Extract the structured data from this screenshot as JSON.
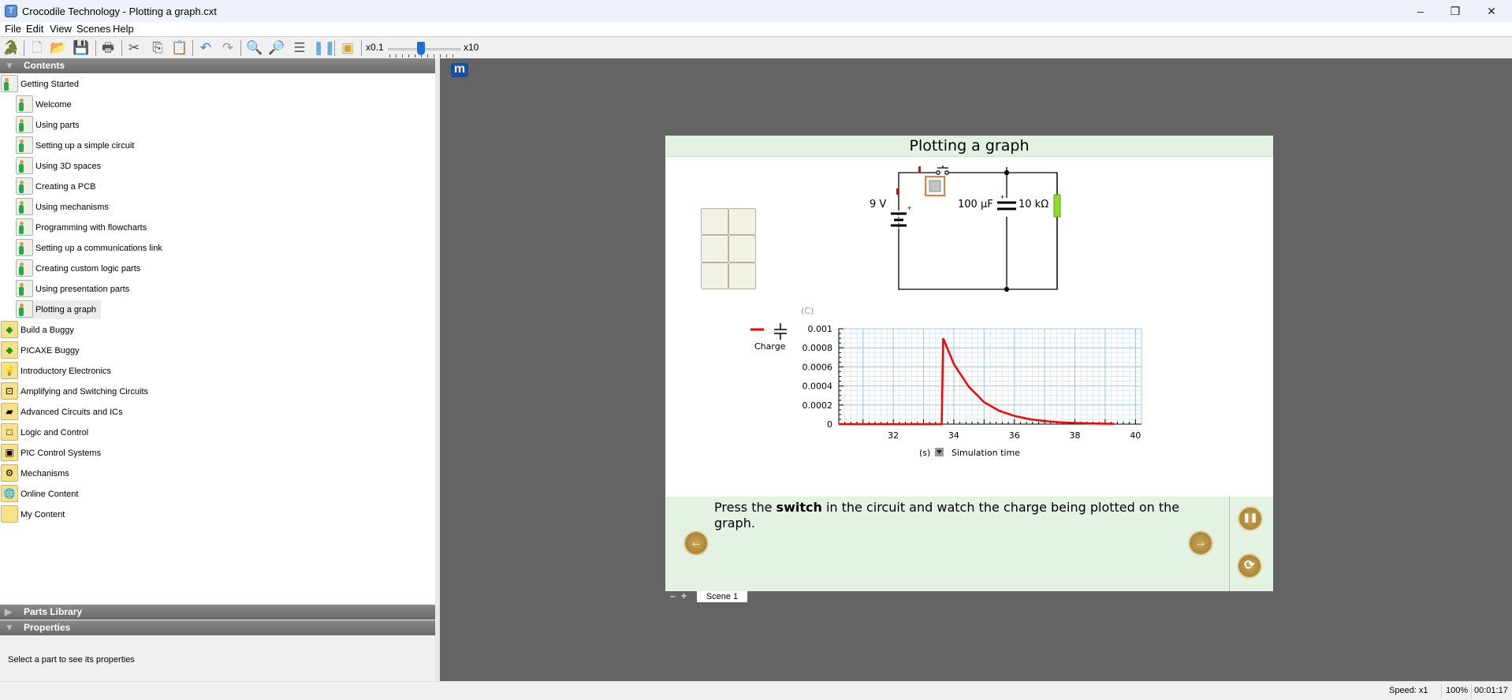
{
  "window": {
    "title": "Crocodile Technology - Plotting a graph.cxt",
    "app_icon": "T",
    "minimize": "–",
    "maximize": "❐",
    "close": "✕"
  },
  "menu": [
    "File",
    "Edit",
    "View",
    "Scenes",
    "Help"
  ],
  "toolbar": {
    "icons": [
      "crocodile-icon",
      "new-icon",
      "open-icon",
      "save-icon",
      "print-icon",
      "cut-icon",
      "copy-icon",
      "paste-icon",
      "undo-icon",
      "redo-icon",
      "zoom-in-icon",
      "zoom-out-icon",
      "fit-icon",
      "pause-icon",
      "presentation-icon"
    ],
    "speed_min": "x0.1",
    "speed_max": "x10",
    "speed_value": 0.5
  },
  "panels": {
    "contents": "Contents",
    "parts_library": "Parts Library",
    "properties": "Properties",
    "properties_hint": "Select a part to see its properties"
  },
  "tree": [
    {
      "label": "Getting Started",
      "level": 0,
      "icon": "tutorial-folder"
    },
    {
      "label": "Welcome",
      "level": 1
    },
    {
      "label": "Using parts",
      "level": 1
    },
    {
      "label": "Setting up a simple circuit",
      "level": 1
    },
    {
      "label": "Using 3D spaces",
      "level": 1
    },
    {
      "label": "Creating a PCB",
      "level": 1
    },
    {
      "label": "Using mechanisms",
      "level": 1
    },
    {
      "label": "Programming with flowcharts",
      "level": 1
    },
    {
      "label": "Setting up a communications link",
      "level": 1
    },
    {
      "label": "Creating custom logic parts",
      "level": 1
    },
    {
      "label": "Using presentation parts",
      "level": 1
    },
    {
      "label": "Plotting a graph",
      "level": 1,
      "selected": true
    },
    {
      "label": "Build a Buggy",
      "level": 0,
      "icon": "buggy"
    },
    {
      "label": "PICAXE Buggy",
      "level": 0,
      "icon": "buggy"
    },
    {
      "label": "Introductory Electronics",
      "level": 0,
      "icon": "bulb"
    },
    {
      "label": "Amplifying and Switching Circuits",
      "level": 0,
      "icon": "circuit"
    },
    {
      "label": "Advanced Circuits and ICs",
      "level": 0,
      "icon": "chip"
    },
    {
      "label": "Logic and Control",
      "level": 0,
      "icon": "logic"
    },
    {
      "label": "PIC Control Systems",
      "level": 0,
      "icon": "pic"
    },
    {
      "label": "Mechanisms",
      "level": 0,
      "icon": "gear"
    },
    {
      "label": "Online Content",
      "level": 0,
      "icon": "globe"
    },
    {
      "label": "My Content",
      "level": 0,
      "icon": "folder"
    }
  ],
  "slide": {
    "title": "Plotting a graph",
    "circuit": {
      "battery": "9 V",
      "capacitor": "100 µF",
      "resistor": "10 kΩ"
    },
    "text_pre": "Press the ",
    "text_bold": "switch",
    "text_post": " in the circuit and watch the charge being plotted on the graph.",
    "buttons": {
      "prev": "←",
      "next": "→",
      "pause": "❚❚",
      "restart": "⟳"
    }
  },
  "scene_tab": "Scene 1",
  "scene_minus": "–",
  "scene_plus": "+",
  "status": {
    "speed": "Speed: x1",
    "zoom": "100%",
    "time": "00:01:17"
  },
  "chart_data": {
    "type": "line",
    "title": "",
    "legend": "Charge",
    "legend_placement": "top-left",
    "ylabel": "(C)",
    "xlabel": "Simulation time",
    "xunit": "(s)",
    "xlim": [
      30.2,
      40.2
    ],
    "ylim": [
      0,
      0.001
    ],
    "xticks": [
      "32",
      "34",
      "36",
      "38",
      "40"
    ],
    "xtick_values": [
      32,
      34,
      36,
      38,
      40
    ],
    "yticks": [
      "0",
      "0.0002",
      "0.0004",
      "0.0006",
      "0.0008",
      "0.001"
    ],
    "ytick_values": [
      0,
      0.0002,
      0.0004,
      0.0006,
      0.0008,
      0.001
    ],
    "series": [
      {
        "name": "Charge",
        "color": "#ff0000",
        "x": [
          30.2,
          33.6,
          33.65,
          34,
          34.5,
          35,
          35.5,
          36,
          36.5,
          37,
          37.5,
          38,
          38.5,
          39,
          39.3
        ],
        "y": [
          0,
          0,
          0.0009,
          0.00063,
          0.00039,
          0.00023,
          0.00014,
          8.6e-05,
          5.2e-05,
          3.2e-05,
          1.9e-05,
          1.2e-05,
          7e-06,
          4e-06,
          3e-06
        ]
      }
    ],
    "grid": true
  }
}
